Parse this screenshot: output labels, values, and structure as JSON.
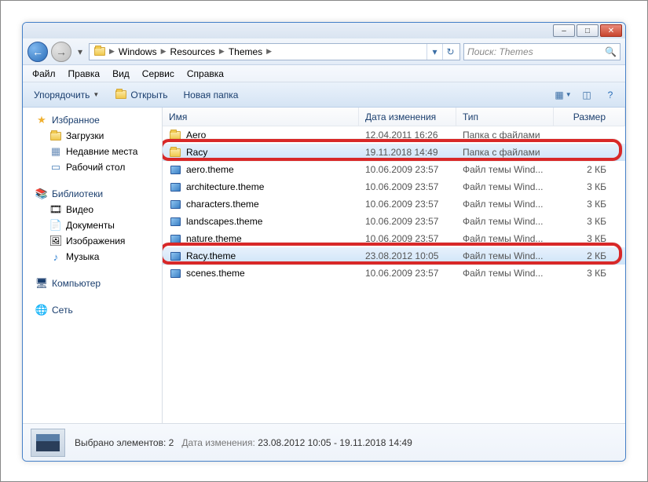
{
  "window": {
    "minimize": "–",
    "maximize": "□",
    "close": "✕"
  },
  "nav": {
    "crumbs": [
      "Windows",
      "Resources",
      "Themes"
    ],
    "search_placeholder": "Поиск: Themes"
  },
  "menu": [
    "Файл",
    "Правка",
    "Вид",
    "Сервис",
    "Справка"
  ],
  "toolbar": {
    "organize": "Упорядочить",
    "open": "Открыть",
    "newfolder": "Новая папка"
  },
  "sidebar": {
    "favorites": {
      "label": "Избранное",
      "items": [
        "Загрузки",
        "Недавние места",
        "Рабочий стол"
      ]
    },
    "libraries": {
      "label": "Библиотеки",
      "items": [
        "Видео",
        "Документы",
        "Изображения",
        "Музыка"
      ]
    },
    "computer": {
      "label": "Компьютер"
    },
    "network": {
      "label": "Сеть"
    }
  },
  "columns": {
    "name": "Имя",
    "date": "Дата изменения",
    "type": "Тип",
    "size": "Размер"
  },
  "rows": [
    {
      "icon": "folder",
      "name": "Aero",
      "date": "12.04.2011 16:26",
      "type": "Папка с файлами",
      "size": "",
      "sel": false
    },
    {
      "icon": "folder",
      "name": "Racy",
      "date": "19.11.2018 14:49",
      "type": "Папка с файлами",
      "size": "",
      "sel": true,
      "ring": true
    },
    {
      "icon": "theme",
      "name": "aero.theme",
      "date": "10.06.2009 23:57",
      "type": "Файл темы Wind...",
      "size": "2 КБ",
      "sel": false
    },
    {
      "icon": "theme",
      "name": "architecture.theme",
      "date": "10.06.2009 23:57",
      "type": "Файл темы Wind...",
      "size": "3 КБ",
      "sel": false
    },
    {
      "icon": "theme",
      "name": "characters.theme",
      "date": "10.06.2009 23:57",
      "type": "Файл темы Wind...",
      "size": "3 КБ",
      "sel": false
    },
    {
      "icon": "theme",
      "name": "landscapes.theme",
      "date": "10.06.2009 23:57",
      "type": "Файл темы Wind...",
      "size": "3 КБ",
      "sel": false
    },
    {
      "icon": "theme",
      "name": "nature.theme",
      "date": "10.06.2009 23:57",
      "type": "Файл темы Wind...",
      "size": "3 КБ",
      "sel": false
    },
    {
      "icon": "theme",
      "name": "Racy.theme",
      "date": "23.08.2012 10:05",
      "type": "Файл темы Wind...",
      "size": "2 КБ",
      "sel": true,
      "ring": true
    },
    {
      "icon": "theme",
      "name": "scenes.theme",
      "date": "10.06.2009 23:57",
      "type": "Файл темы Wind...",
      "size": "3 КБ",
      "sel": false
    }
  ],
  "status": {
    "line1": "Выбрано элементов: 2",
    "date_label": "Дата изменения:",
    "date_value": "23.08.2012 10:05 - 19.11.2018 14:49"
  }
}
